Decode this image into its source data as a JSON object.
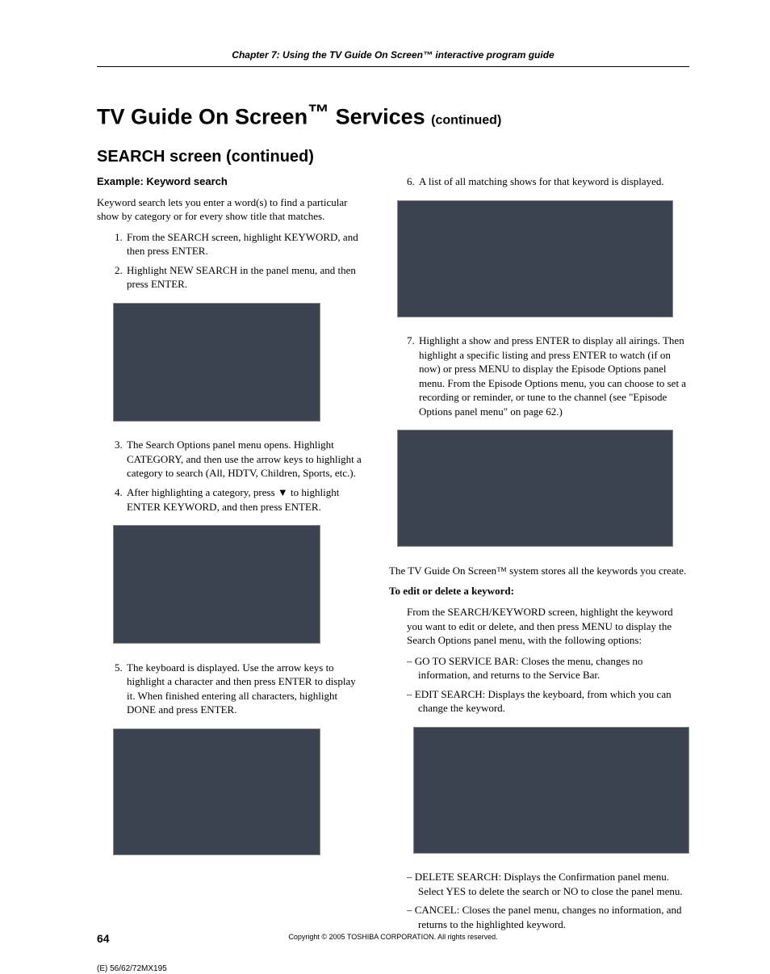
{
  "chapterHeader": "Chapter 7: Using the TV Guide On Screen™ interactive program guide",
  "mainTitleA": "TV Guide On Screen",
  "mainTitleB": " Services ",
  "mainTitleCont": "(continued)",
  "sectionTitle": "SEARCH screen (continued)",
  "example": "Example: Keyword search",
  "introLeft": "Keyword search lets you enter a word(s) to find a particular show by category or for every show title that matches.",
  "left": {
    "s1": "From the SEARCH screen, highlight KEYWORD, and then press ENTER.",
    "s2": "Highlight NEW SEARCH in the panel menu, and then press ENTER.",
    "s3": "The Search Options panel menu opens. Highlight CATEGORY, and then use the arrow keys to highlight a category to search (All, HDTV, Children, Sports, etc.).",
    "s4": "After highlighting a category, press ▼ to highlight ENTER KEYWORD, and then press ENTER.",
    "s5": "The keyboard is displayed. Use the arrow keys to highlight a character and then press ENTER to display it. When finished entering all characters, highlight DONE and press ENTER."
  },
  "right": {
    "s6": "A list of all matching shows for that keyword is displayed.",
    "s7": "Highlight a show and press ENTER to display all airings. Then highlight a specific listing and press ENTER to watch (if on now) or press MENU to display the Episode Options panel menu. From the Episode Options menu, you can choose to set a recording or reminder, or tune to the channel (see \"Episode Options panel menu\" on page 62.)",
    "afterImg": "The TV Guide On Screen™ system stores all the keywords you create.",
    "editTitle": "To edit or delete a keyword:",
    "editIntro": "From the SEARCH/KEYWORD screen, highlight the keyword you want to edit or delete, and then press MENU to display the Search Options panel menu, with the following options:",
    "d1": "GO TO SERVICE BAR: Closes the menu, changes no information, and returns to the Service Bar.",
    "d2": "EDIT SEARCH: Displays the keyboard, from which you can change the keyword.",
    "d3": "DELETE SEARCH: Displays the Confirmation panel menu. Select YES to delete the search or NO to close the panel menu.",
    "d4": "CANCEL: Closes the panel menu, changes no information, and returns to the highlighted keyword."
  },
  "copyright": "Copyright © 2005 TOSHIBA CORPORATION. All rights reserved.",
  "pageNum": "64",
  "docCode": "(E) 56/62/72MX195"
}
